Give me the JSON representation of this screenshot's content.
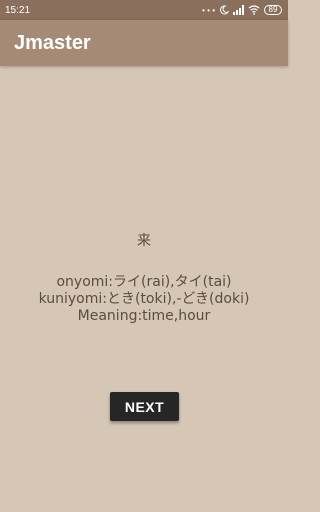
{
  "status_bar": {
    "time": "15:21",
    "icons": [
      "dots-icon",
      "moon-icon",
      "signal-icon",
      "wifi-icon",
      "battery-icon"
    ],
    "dots": "• • •",
    "battery": "89"
  },
  "app_bar": {
    "title": "Jmaster",
    "color": "#a58a76"
  },
  "card": {
    "kanji": "来",
    "onyomi": "onyomi:ライ(rai),タイ(tai)",
    "kuniyomi": "kuniyomi:とき(toki),-どき(doki)",
    "meaning": "Meaning:time,hour"
  },
  "next_button": {
    "label": "NEXT"
  },
  "colors": {
    "background": "#d6c6b5",
    "status_bar": "#8a6f5c",
    "text": "#5b4c44",
    "button": "#262626"
  }
}
